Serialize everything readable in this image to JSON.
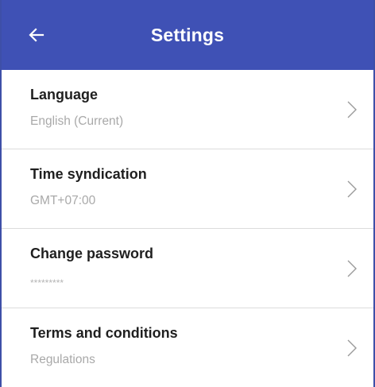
{
  "header": {
    "title": "Settings",
    "back_icon": "arrow-left-icon"
  },
  "settings": {
    "items": [
      {
        "title": "Language",
        "subtitle": "English (Current)"
      },
      {
        "title": "Time syndication",
        "subtitle": "GMT+07:00"
      },
      {
        "title": "Change password",
        "subtitle": "*********"
      },
      {
        "title": "Terms and conditions",
        "subtitle": "Regulations"
      }
    ]
  },
  "colors": {
    "app_bar": "#3f51b5",
    "title_text": "#1f1f1f",
    "subtitle_text": "#a9a9a9",
    "divider": "#dcdcdc"
  }
}
